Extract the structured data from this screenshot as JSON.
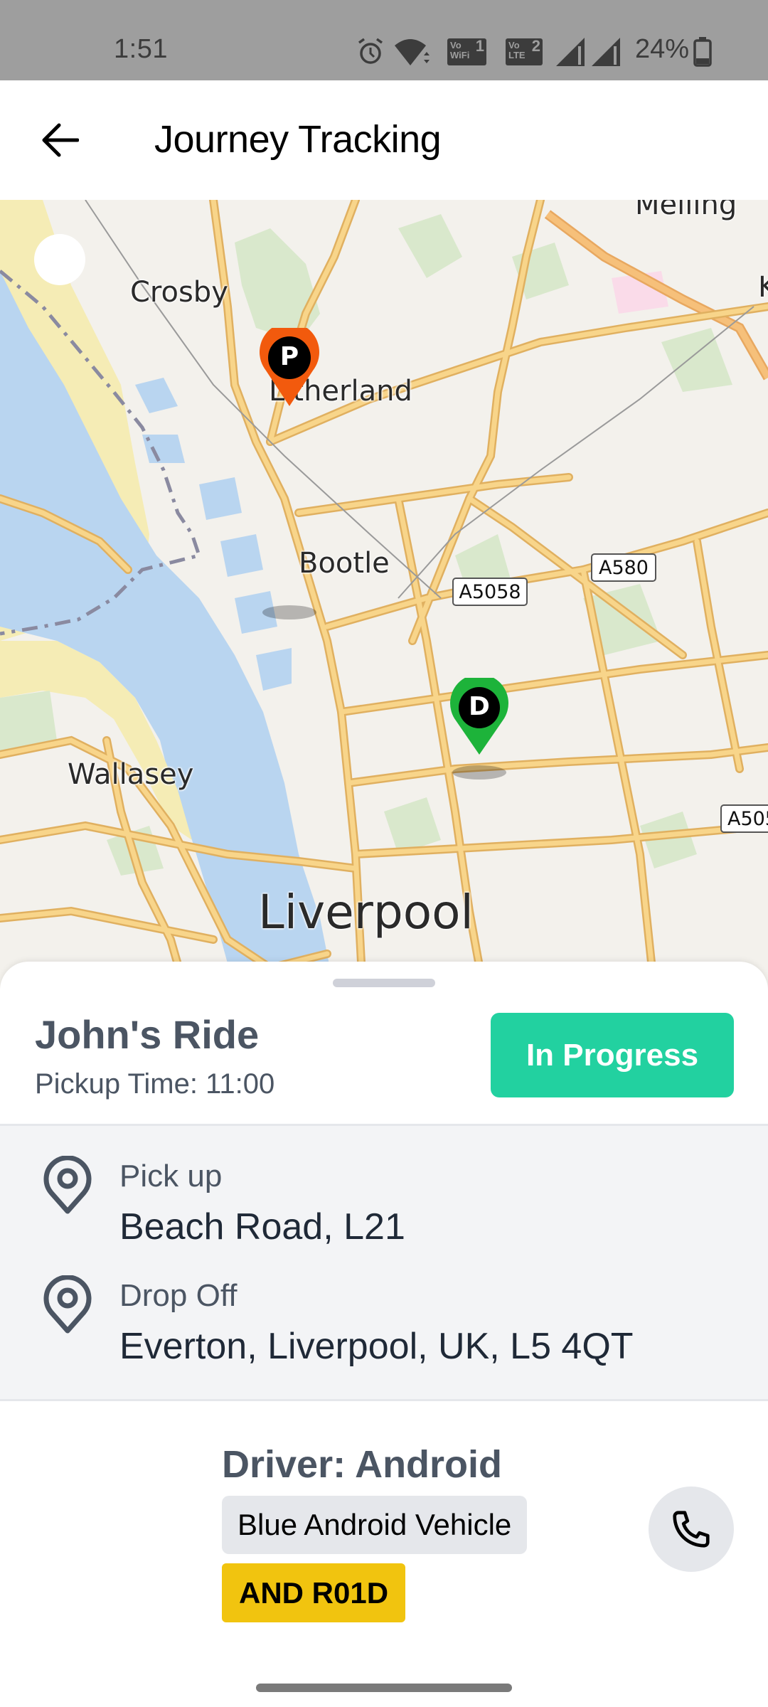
{
  "status_bar": {
    "time": "1:51",
    "battery_text": "24%",
    "icons": [
      "alarm-icon",
      "wifi-icon",
      "vowifi-1-icon",
      "volte-2-icon",
      "signal-sim1-icon",
      "signal-sim2-icon",
      "battery-icon"
    ],
    "vowifi_top": "Vo",
    "vowifi_bottom": "WiFi",
    "vowifi_num": "1",
    "volte_top": "Vo",
    "volte_bottom": "LTE",
    "volte_num": "2"
  },
  "app_bar": {
    "back_icon": "arrow-left-icon",
    "title": "Journey Tracking"
  },
  "map": {
    "place_labels": {
      "crosby": "Crosby",
      "litherland": "Litherland",
      "bootle": "Bootle",
      "wallasey": "Wallasey",
      "liverpool": "Liverpool",
      "melling": "Melling",
      "kirkby_partial": "K"
    },
    "road_shields": {
      "a5058": "A5058",
      "a580": "A580",
      "a505_partial": "A505"
    },
    "markers": {
      "pickup": {
        "letter": "P",
        "color": "#f25a0d"
      },
      "dropoff": {
        "letter": "D",
        "color": "#1db33a"
      }
    },
    "colors": {
      "land": "#f3f1ec",
      "water": "#b9d5f0",
      "beach": "#f5ecb5",
      "park": "#d9e8cc",
      "road": "#f6c873",
      "motorway": "#f2b46a"
    }
  },
  "ride": {
    "title": "John's Ride",
    "pickup_time": "Pickup Time: 11:00",
    "status": "In Progress",
    "status_color": "#22d1a0"
  },
  "route": {
    "pickup": {
      "label": "Pick up",
      "address": "Beach Road, L21",
      "icon": "location-pin-icon"
    },
    "dropoff": {
      "label": "Drop Off",
      "address": "Everton, Liverpool, UK, L5 4QT",
      "icon": "location-pin-icon"
    }
  },
  "driver": {
    "name": "Driver: Android",
    "vehicle": "Blue Android Vehicle",
    "plate": "AND R01D",
    "plate_color": "#f1c40f",
    "call_icon": "phone-icon"
  }
}
